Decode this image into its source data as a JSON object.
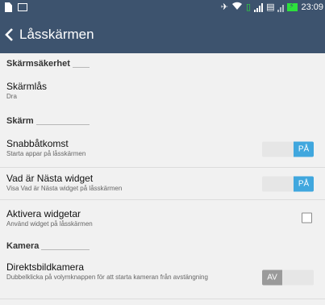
{
  "status_bar": {
    "time": "23:09",
    "icons": [
      "file-icon",
      "message-icon",
      "mute-icon",
      "wifi-icon",
      "sim-icon",
      "signal-icon",
      "clipboard-icon",
      "signal-icon-2",
      "battery-charging-icon"
    ],
    "accent": "#2de13c"
  },
  "app_bar": {
    "title": "Låsskärmen",
    "background": "#3d536e"
  },
  "sections": [
    {
      "header": "Skärmsäkerhet",
      "items": [
        {
          "title": "Skärmlås",
          "subtitle": "Dra"
        }
      ]
    },
    {
      "header": "Skärm",
      "items": [
        {
          "title": "Snabbåtkomst",
          "subtitle": "Starta appar på låsskärmen",
          "control": "toggle",
          "state": "on",
          "label": "PÅ"
        },
        {
          "title": "Vad är Nästa widget",
          "subtitle": "Visa Vad är Nästa widget på låsskärmen",
          "control": "toggle",
          "state": "on",
          "label": "PÅ"
        },
        {
          "title": "Aktivera widgetar",
          "subtitle": "Använd widget på låsskärmen",
          "control": "checkbox",
          "checked": false
        }
      ]
    },
    {
      "header": "Kamera",
      "items": [
        {
          "title": "Direktsbildkamera",
          "subtitle": "Dubbelklicka på volymknappen för att starta kameran från avstängning",
          "control": "toggle",
          "state": "off",
          "label": "AV"
        }
      ]
    }
  ],
  "colors": {
    "toggle_on": "#40a7de",
    "toggle_off": "#9a9a9a"
  }
}
